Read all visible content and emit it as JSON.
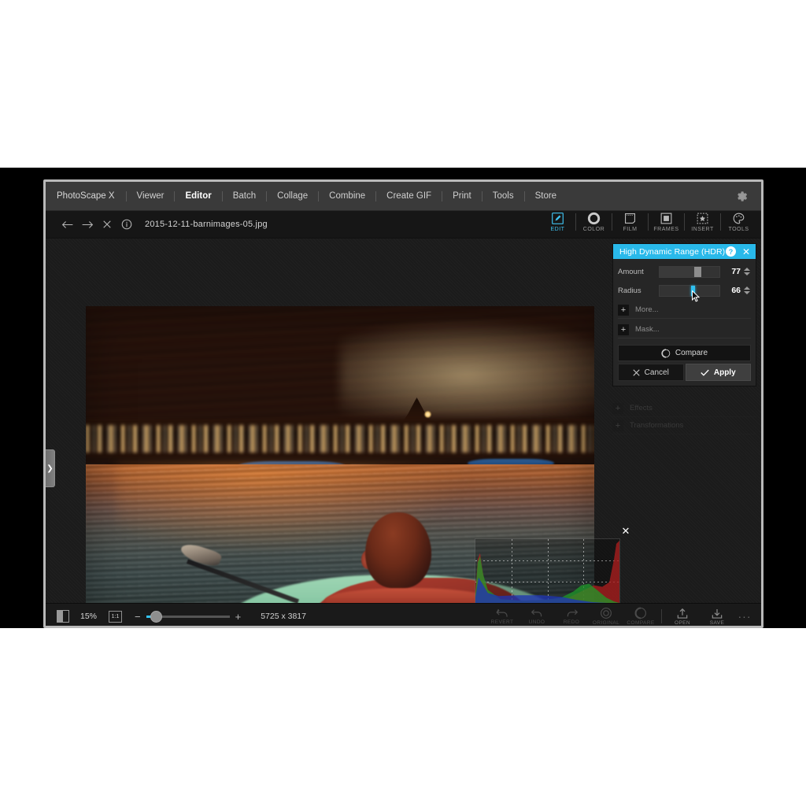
{
  "app": {
    "name": "PhotoScape X",
    "menu": [
      {
        "label": "PhotoScape X",
        "active": false
      },
      {
        "label": "Viewer",
        "active": false
      },
      {
        "label": "Editor",
        "active": true
      },
      {
        "label": "Batch",
        "active": false
      },
      {
        "label": "Collage",
        "active": false
      },
      {
        "label": "Combine",
        "active": false
      },
      {
        "label": "Create GIF",
        "active": false
      },
      {
        "label": "Print",
        "active": false
      },
      {
        "label": "Tools",
        "active": false
      },
      {
        "label": "Store",
        "active": false
      }
    ],
    "settings_icon": "gear-icon"
  },
  "filebar": {
    "back_icon": "arrow-left-icon",
    "forward_icon": "arrow-right-icon",
    "close_icon": "close-icon",
    "info_icon": "info-icon",
    "filename": "2015-12-11-barnimages-05.jpg"
  },
  "mode_tabs": [
    {
      "label": "EDIT",
      "icon": "pencil-square-icon",
      "active": true
    },
    {
      "label": "COLOR",
      "icon": "color-ring-icon",
      "active": false
    },
    {
      "label": "FILM",
      "icon": "film-frame-icon",
      "active": false
    },
    {
      "label": "FRAMES",
      "icon": "frame-square-icon",
      "active": false
    },
    {
      "label": "INSERT",
      "icon": "star-dashed-icon",
      "active": false
    },
    {
      "label": "TOOLS",
      "icon": "palette-icon",
      "active": false
    }
  ],
  "left_panel": {
    "expand_icon": "chevron-right-icon"
  },
  "hdr_panel": {
    "title": "High Dynamic Range (HDR)",
    "help_label": "?",
    "close_icon": "close-icon",
    "sliders": [
      {
        "label": "Amount",
        "value": "77",
        "fill_pct": 62,
        "knob_pct": 62,
        "accent": false
      },
      {
        "label": "Radius",
        "value": "66",
        "fill_pct": 0,
        "knob_pct": 53,
        "accent": true
      }
    ],
    "expanders": [
      {
        "label": "More...",
        "plus": "+"
      },
      {
        "label": "Mask...",
        "plus": "+"
      }
    ],
    "compare_label": "Compare",
    "compare_icon": "compare-circle-icon",
    "cancel_label": "Cancel",
    "cancel_icon": "x-icon",
    "apply_label": "Apply",
    "apply_icon": "check-icon"
  },
  "dim_sections": [
    {
      "label": "Effects",
      "plus": "+"
    },
    {
      "label": "Transformations",
      "plus": "+"
    }
  ],
  "histogram": {
    "close_icon": "close-icon",
    "channels": [
      "red",
      "green",
      "blue"
    ]
  },
  "bottombar": {
    "split_view_icon": "split-view-icon",
    "zoom_percent": "15%",
    "fit_label": "1:1",
    "zoom_out": "−",
    "zoom_in": "+",
    "dimensions": "5725 x 3817",
    "tools": [
      {
        "label": "REVERT",
        "icon": "revert-icon",
        "bright": false
      },
      {
        "label": "UNDO",
        "icon": "undo-icon",
        "bright": false
      },
      {
        "label": "REDO",
        "icon": "redo-icon",
        "bright": false
      },
      {
        "label": "ORIGINAL",
        "icon": "original-circle-icon",
        "bright": false
      },
      {
        "label": "COMPARE",
        "icon": "compare-circle-icon",
        "bright": false
      },
      {
        "label": "OPEN",
        "icon": "open-upload-icon",
        "bright": true
      },
      {
        "label": "SAVE",
        "icon": "save-download-icon",
        "bright": true
      }
    ],
    "more_icon": "ellipsis-icon",
    "more_label": "···"
  },
  "photo": {
    "description": "Sunset kayaking scene — boy in red jacket paddling, orange sky over water with many boats"
  },
  "colors": {
    "accent": "#29b9ea",
    "panel_bg": "#262626",
    "menubar_bg": "#3a3a3a",
    "workarea_bg": "#1b1b1b"
  }
}
